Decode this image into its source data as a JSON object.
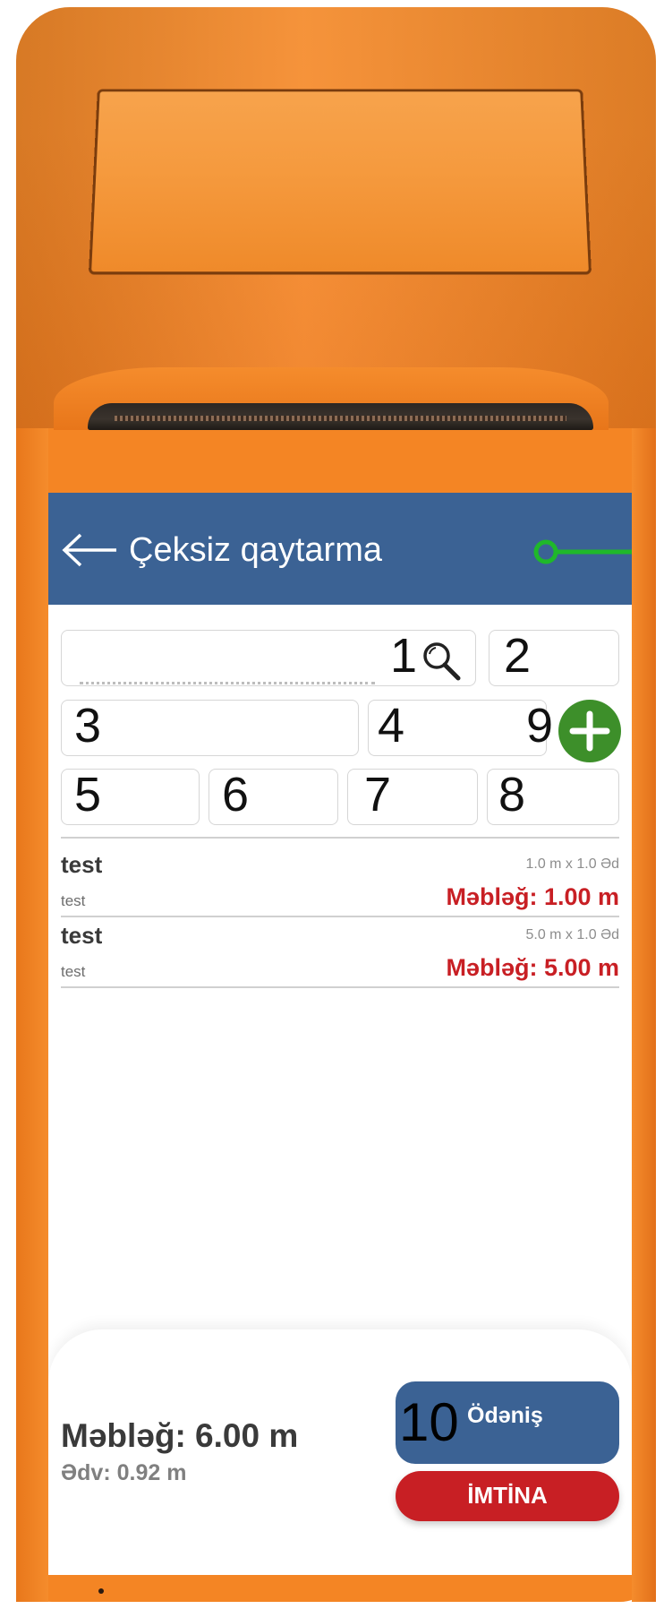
{
  "app_bar": {
    "title": "Çeksiz qaytarma",
    "back_icon": "arrow-left-icon",
    "status_indicator_icon": "green-ring-indicator-icon",
    "background_color": "#3b6294"
  },
  "fields": [
    {
      "id": 1,
      "number": "1"
    },
    {
      "id": 2,
      "number": "2"
    },
    {
      "id": 3,
      "number": "3"
    },
    {
      "id": 4,
      "number": "4"
    },
    {
      "id": 9,
      "number": "9"
    },
    {
      "id": 5,
      "number": "5"
    },
    {
      "id": 6,
      "number": "6"
    },
    {
      "id": 7,
      "number": "7"
    },
    {
      "id": 8,
      "number": "8"
    }
  ],
  "search_icon": "magnifier-icon",
  "add_icon": "plus-icon",
  "items": [
    {
      "name": "test",
      "sub": "test",
      "qty": "1.0 m x 1.0 Əd",
      "amount": "Məbləğ: 1.00 m"
    },
    {
      "name": "test",
      "sub": "test",
      "qty": "5.0 m x 1.0 Əd",
      "amount": "Məbləğ: 5.00 m"
    }
  ],
  "footer": {
    "total": "Məbləğ: 6.00 m",
    "vat": "Ədv: 0.92 m",
    "pay_number": "10",
    "pay_label": "Ödəniş",
    "cancel_label": "İMTİNA"
  },
  "colors": {
    "device_orange": "#f48524",
    "accent_blue": "#3b6294",
    "amount_red": "#c81f24",
    "add_green": "#3d8f2a",
    "indicator_green": "#1fb82a"
  }
}
